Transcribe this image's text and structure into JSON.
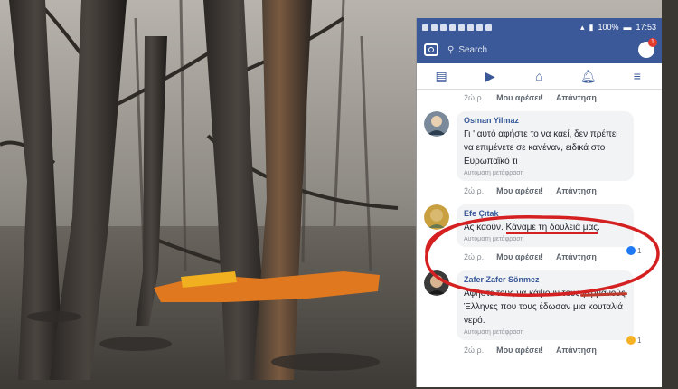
{
  "statusbar": {
    "battery": "100%",
    "time": "17:53"
  },
  "search": {
    "placeholder": "Search",
    "messenger_badge": "1"
  },
  "nav": {
    "icons": [
      "news-feed-icon",
      "video-icon",
      "marketplace-icon",
      "notifications-icon",
      "menu-icon"
    ]
  },
  "top_actions": {
    "time": "2ώ.ρ.",
    "like": "Μου αρέσει!",
    "reply": "Απάντηση"
  },
  "comments": [
    {
      "name": "Osman Yilmaz",
      "text": "Γι ' αυτό αφήστε το να καεί, δεν πρέπει να επιμένετε σε κανέναν, ειδικά στο Ευρωπαϊκό τι",
      "translate": "Αυτόματη μετάφραση",
      "time": "2ώ.ρ.",
      "like": "Μου αρέσει!",
      "reply": "Απάντηση"
    },
    {
      "name": "Efe Çıtak",
      "text_a": "Ας καούν. ",
      "text_b": "Κάναμε τη δουλειά μας",
      "text_c": ".",
      "translate": "Αυτόματη μετάφραση",
      "reaction_count": "1",
      "time": "2ώ.ρ.",
      "like": "Μου αρέσει!",
      "reply": "Απάντηση"
    },
    {
      "name": "Zafer Zafer Sönmez",
      "text_a": "Αφήστε τους να κάψουν τους ",
      "text_struck": "γερμανούς",
      "text_b": " Έλληνες που τους έδωσαν μια κουταλιά νερό.",
      "translate": "Αυτόματη μετάφραση",
      "reaction_count": "1",
      "time": "2ώ.ρ.",
      "like": "Μου αρέσει!",
      "reply": "Απάντηση"
    }
  ],
  "colors": {
    "facebook_blue": "#3b5998",
    "highlight_red": "#d42020"
  }
}
